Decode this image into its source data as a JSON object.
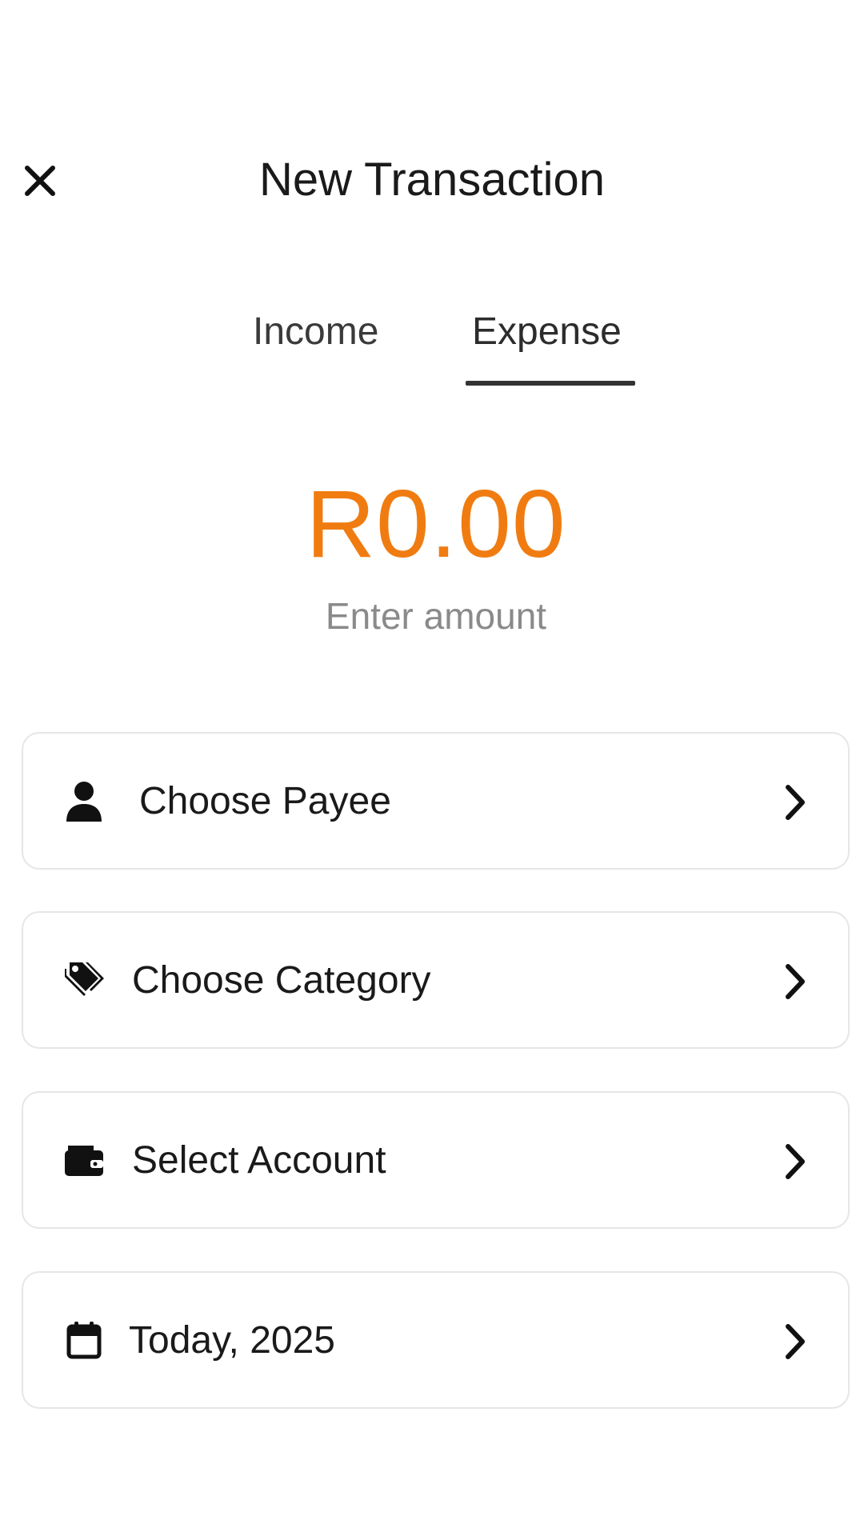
{
  "header": {
    "title": "New Transaction",
    "close_icon": "close-icon"
  },
  "tabs": [
    {
      "label": "Income",
      "active": false
    },
    {
      "label": "Expense",
      "active": true
    }
  ],
  "amount": {
    "value": "R0.00",
    "hint": "Enter amount",
    "color": "#f07c11"
  },
  "options": [
    {
      "label": "Choose Payee",
      "icon": "person-icon"
    },
    {
      "label": "Choose Category",
      "icon": "tags-icon"
    },
    {
      "label": "Select Account",
      "icon": "wallet-icon"
    },
    {
      "label": "Today, 2025",
      "icon": "calendar-icon"
    }
  ]
}
